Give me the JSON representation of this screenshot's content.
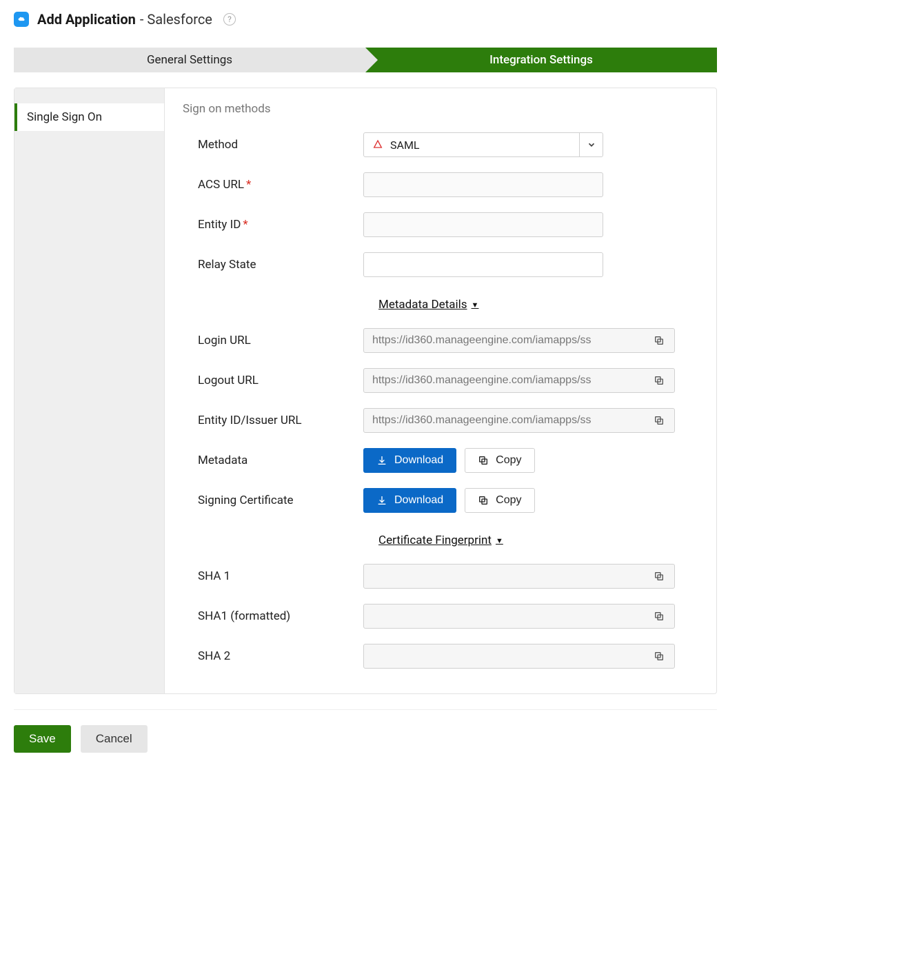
{
  "header": {
    "title_bold": "Add Application",
    "title_sep": " - ",
    "title_app": "Salesforce"
  },
  "stepper": {
    "general": "General Settings",
    "integration": "Integration Settings"
  },
  "sidebar": {
    "sso": "Single Sign On"
  },
  "section": {
    "title": "Sign on methods",
    "metadata_details": "Metadata Details",
    "cert_fingerprint": "Certificate Fingerprint"
  },
  "labels": {
    "method": "Method",
    "acs_url": "ACS URL",
    "entity_id": "Entity ID",
    "relay_state": "Relay State",
    "login_url": "Login URL",
    "logout_url": "Logout URL",
    "issuer_url": "Entity ID/Issuer URL",
    "metadata": "Metadata",
    "signing_cert": "Signing Certificate",
    "sha1": "SHA 1",
    "sha1_fmt": "SHA1 (formatted)",
    "sha2": "SHA 2"
  },
  "values": {
    "method_selected": "SAML",
    "acs_url": "",
    "entity_id": "",
    "relay_state": "",
    "login_url": "https://id360.manageengine.com/iamapps/ss",
    "logout_url": "https://id360.manageengine.com/iamapps/ss",
    "issuer_url": "https://id360.manageengine.com/iamapps/ss",
    "sha1": "",
    "sha1_fmt": "",
    "sha2": ""
  },
  "buttons": {
    "download": "Download",
    "copy": "Copy",
    "save": "Save",
    "cancel": "Cancel"
  }
}
